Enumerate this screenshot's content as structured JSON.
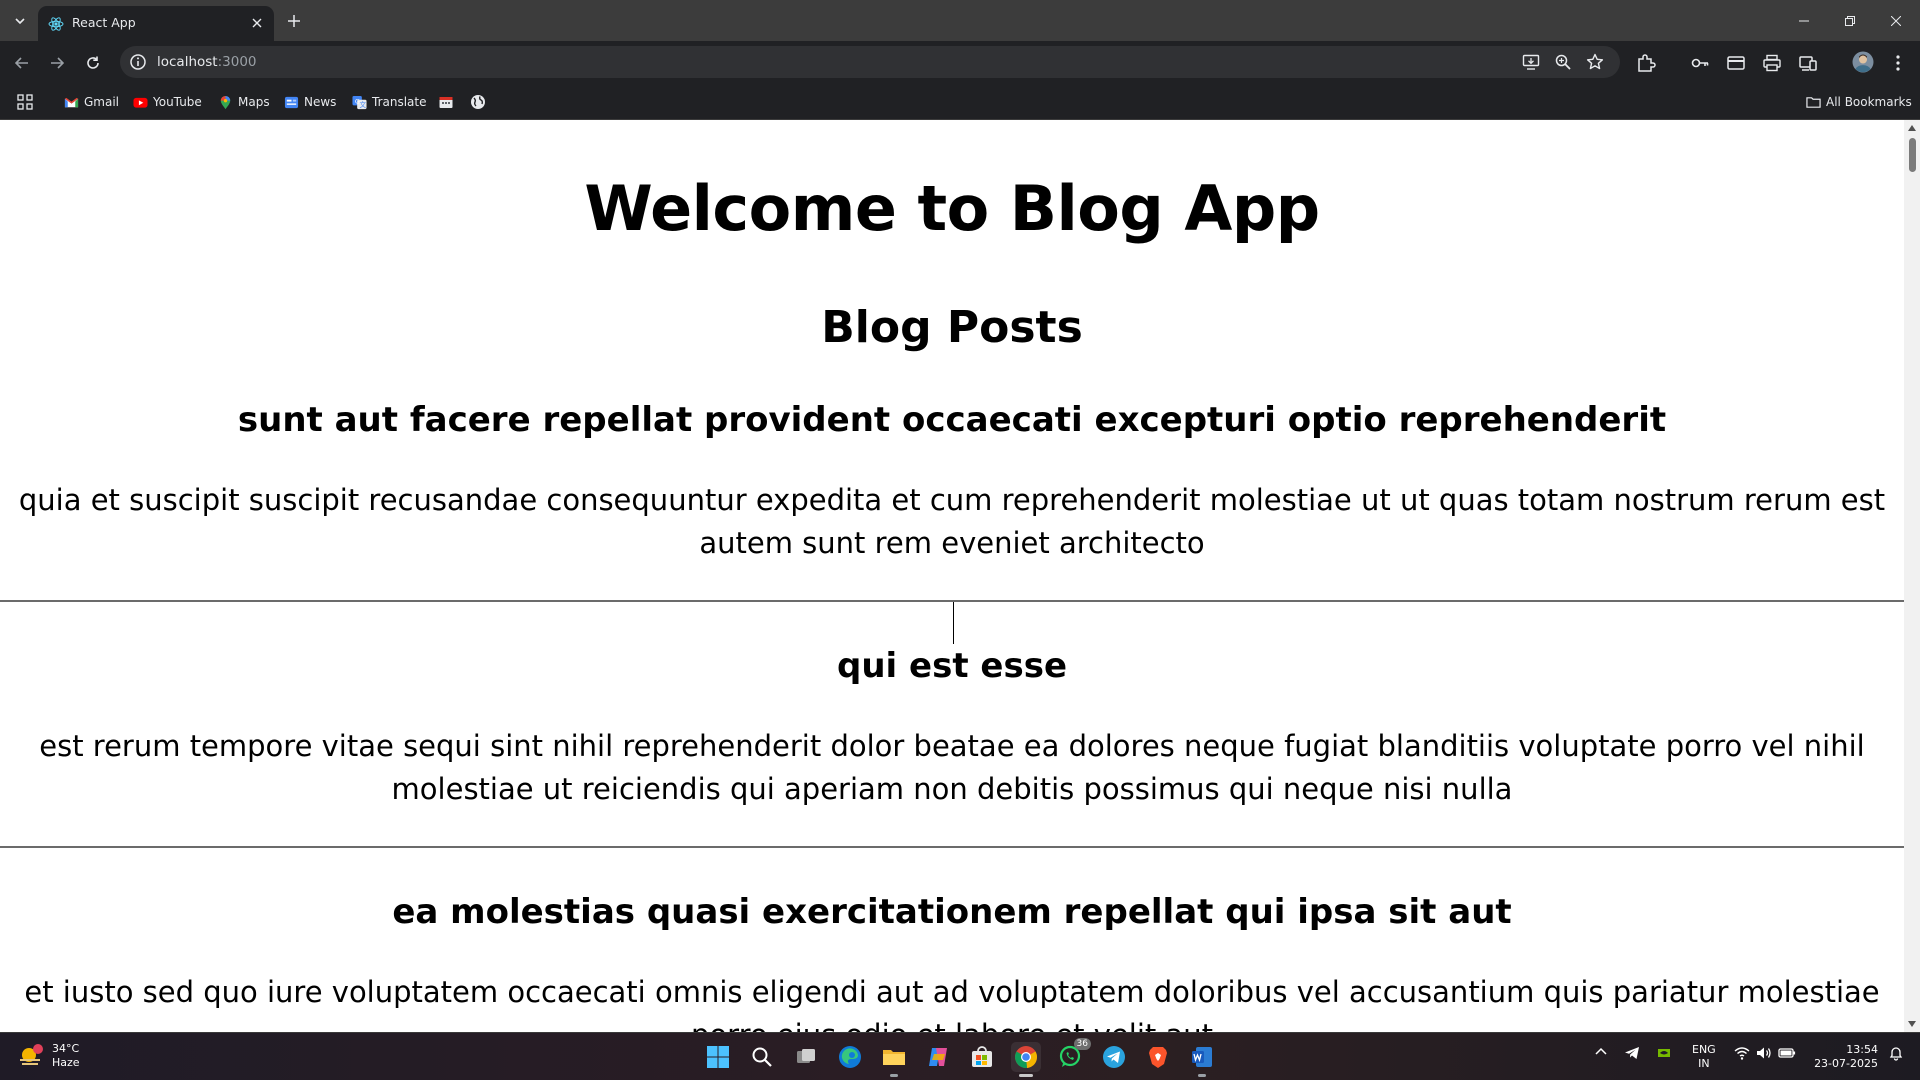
{
  "browser": {
    "tab_title": "React App",
    "url_host": "localhost",
    "url_port": ":3000",
    "bookmarks": [
      "Gmail",
      "YouTube",
      "Maps",
      "News",
      "Translate"
    ],
    "all_bookmarks": "All Bookmarks"
  },
  "page": {
    "title": "Welcome to Blog App",
    "posts_heading": "Blog Posts",
    "posts": [
      {
        "title": "sunt aut facere repellat provident occaecati excepturi optio reprehenderit",
        "body": "quia et suscipit suscipit recusandae consequuntur expedita et cum reprehenderit molestiae ut ut quas totam nostrum rerum est autem sunt rem eveniet architecto"
      },
      {
        "title": "qui est esse",
        "body": "est rerum tempore vitae sequi sint nihil reprehenderit dolor beatae ea dolores neque fugiat blanditiis voluptate porro vel nihil molestiae ut reiciendis qui aperiam non debitis possimus qui neque nisi nulla"
      },
      {
        "title": "ea molestias quasi exercitationem repellat qui ipsa sit aut",
        "body": "et iusto sed quo iure voluptatem occaecati omnis eligendi aut ad voluptatem doloribus vel accusantium quis pariatur molestiae porro eius odio et labore et velit aut"
      }
    ]
  },
  "taskbar": {
    "weather_temp": "34°C",
    "weather_desc": "Haze",
    "whatsapp_badge": "36",
    "lang_line1": "ENG",
    "lang_line2": "IN",
    "time": "13:54",
    "date": "23-07-2025"
  },
  "colors": {
    "chrome_frame": "#3c3c3c",
    "chrome_toolbar": "#202124",
    "page_bg": "#ffffff",
    "text": "#000000"
  }
}
